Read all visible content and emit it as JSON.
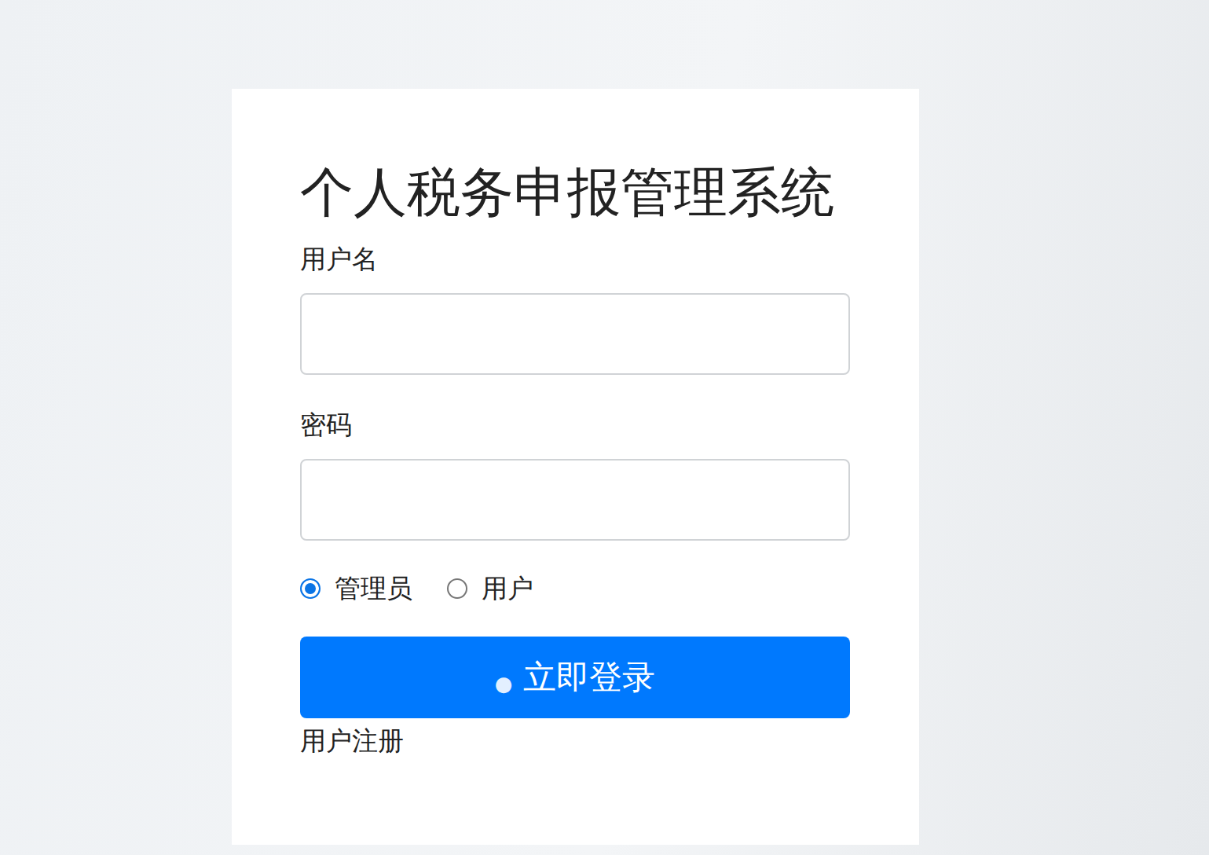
{
  "window": {
    "title": "个人税务申报管理系统"
  },
  "fields": [
    {
      "label": "用户名",
      "value": "",
      "kind": "text"
    },
    {
      "label": "密码",
      "value": "",
      "kind": "password"
    }
  ],
  "roles": [
    {
      "label": "管理员",
      "selected": true
    },
    {
      "label": "用户",
      "selected": false
    }
  ],
  "login_button": {
    "icon": "●",
    "label": "立即登录"
  },
  "register_link": "用户注册"
}
